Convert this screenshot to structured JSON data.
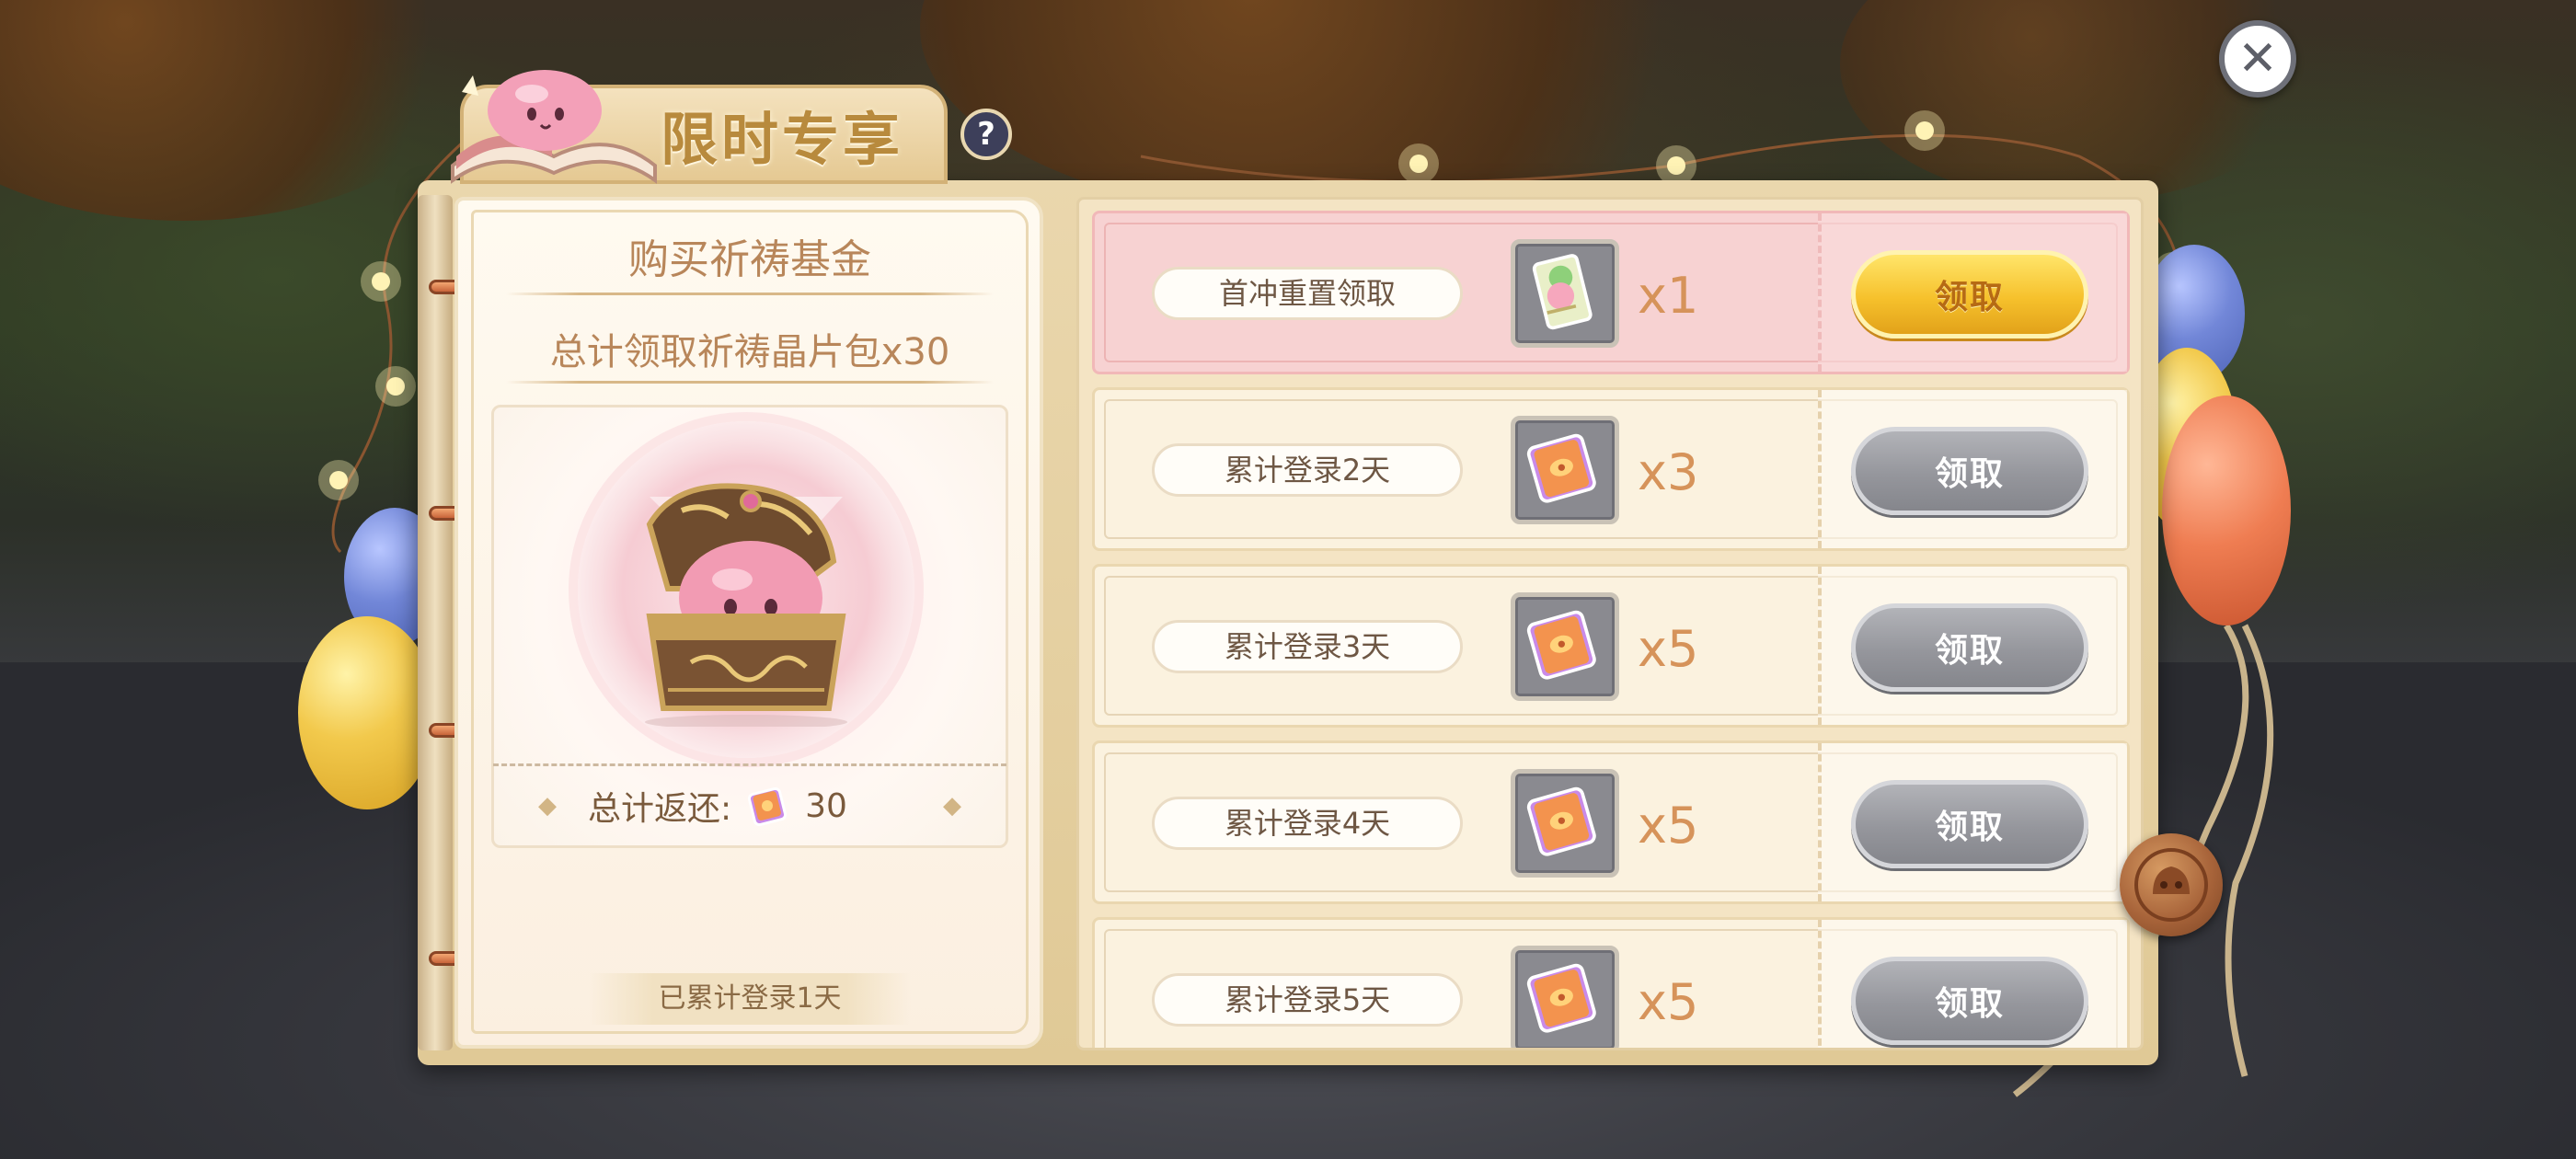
{
  "window": {
    "title": "限时专享"
  },
  "close_button": {
    "glyph": "✕",
    "icon": "close-icon"
  },
  "help_button": {
    "glyph": "?",
    "icon": "help-icon"
  },
  "left_panel": {
    "title": "购买祈祷基金",
    "subtitle": "总计领取祈祷晶片包x30",
    "reward_icon": "treasure-chest-icon",
    "refund_label": "总计返还:",
    "refund_icon": "prayer-crystal-pack-icon",
    "refund_amount": "30",
    "login_status": "已累计登录1天"
  },
  "rewards": [
    {
      "label": "首冲重置领取",
      "item_icon": "reset-ticket-icon",
      "quantity": "x1",
      "button": "领取",
      "claimable": true
    },
    {
      "label": "累计登录2天",
      "item_icon": "prayer-crystal-pack-icon",
      "quantity": "x3",
      "button": "领取",
      "claimable": false
    },
    {
      "label": "累计登录3天",
      "item_icon": "prayer-crystal-pack-icon",
      "quantity": "x5",
      "button": "领取",
      "claimable": false
    },
    {
      "label": "累计登录4天",
      "item_icon": "prayer-crystal-pack-icon",
      "quantity": "x5",
      "button": "领取",
      "claimable": false
    },
    {
      "label": "累计登录5天",
      "item_icon": "prayer-crystal-pack-icon",
      "quantity": "x5",
      "button": "领取",
      "claimable": false
    }
  ],
  "colors": {
    "accent_gold": "#b88a3d",
    "claim_active": "#f6c12c",
    "claim_disabled": "#95969c",
    "highlight_row": "#f7d2d2",
    "quantity_text": "#d6935a"
  }
}
